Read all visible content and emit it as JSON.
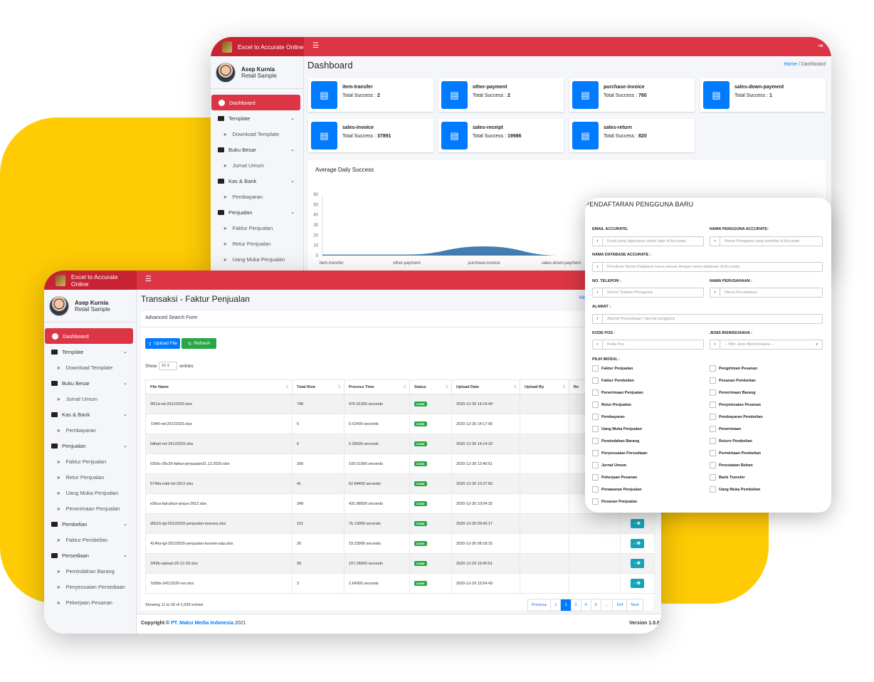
{
  "app": {
    "brand": "Excel to Accurate Online",
    "logout_icon": "logout-icon"
  },
  "user": {
    "name": "Asep Kurnia",
    "company": "Retail Sample"
  },
  "sidebar": {
    "dashboard": "Dashboard",
    "template": "Template",
    "download_template": "Download Template",
    "buku_besar": "Buku Besar",
    "jurnal_umum": "Jurnal Umum",
    "kas_bank": "Kas & Bank",
    "pembayaran": "Pembayaran",
    "penjualan": "Penjualan",
    "faktur_penjualan": "Faktur Penjualan",
    "retur_penjualan": "Retur Penjualan",
    "uang_muka_penjualan": "Uang Muka Penjualan",
    "penerimaan_penjualan": "Penerimaan Penjualan",
    "pembelian": "Pembelian",
    "faktur_pembelian": "Faktur Pembelian",
    "persediaan": "Persediaan",
    "pemindahan_barang": "Pemindahan Barang",
    "penyesuaian_persediaan": "Penyesuaian Persediaan",
    "pekerjaan_pesanan": "Pekerjaan Pesanan"
  },
  "dashboard": {
    "title": "Dashboard",
    "breadcrumb_home": "Home",
    "breadcrumb_sep": "/",
    "breadcrumb_current": "Dashboard",
    "cards": [
      {
        "name": "item-transfer",
        "label": "Total Success :",
        "value": "2"
      },
      {
        "name": "other-payment",
        "label": "Total Success :",
        "value": "2"
      },
      {
        "name": "purchase-invoice",
        "label": "Total Success :",
        "value": "780"
      },
      {
        "name": "sales-down-payment",
        "label": "Total Success :",
        "value": "1"
      },
      {
        "name": "sales-invoice",
        "label": "Total Success :",
        "value": "37891"
      },
      {
        "name": "sales-receipt",
        "label": "Total Success :",
        "value": "19986"
      },
      {
        "name": "sales-return",
        "label": "Total Success :",
        "value": "820"
      }
    ]
  },
  "chart_data": {
    "type": "area",
    "title": "Average Daily Success",
    "categories": [
      "item-transfer",
      "other-payment",
      "purchase-invoice",
      "sales-down-payment"
    ],
    "values": [
      1,
      1,
      9,
      0
    ],
    "ylim": [
      0,
      60
    ],
    "yticks": [
      "0",
      "10",
      "20",
      "30",
      "40",
      "50",
      "60"
    ],
    "color": "#2f6fa8"
  },
  "transaksi": {
    "title": "Transaksi - Faktur Penjualan",
    "breadcrumb_partial": "Ho",
    "search_form": "Advanced Search Form",
    "upload_label": "Upload File",
    "refresh_label": "Refresh",
    "show_label": "Show",
    "show_value": "10",
    "entries_label": "entries",
    "columns": [
      "File Name",
      "Total Row",
      "Process Time",
      "Status",
      "Upload Date",
      "Upload By",
      "Re"
    ],
    "rows": [
      {
        "file": "3f51d-nd-29122020.xlsx",
        "total": "798",
        "time": "476.91300 seconds",
        "status": "DONE",
        "date": "2020-12-30 14:19:44"
      },
      {
        "file": "7346f-nd-29122020.xlsx",
        "total": "5",
        "time": "0.02400 seconds",
        "status": "DONE",
        "date": "2020-12-30 14:17:06"
      },
      {
        "file": "0dba0-nd-29122020.xlsx",
        "total": "6",
        "time": "0.39500 seconds",
        "status": "DONE",
        "date": "2020-12-30 14:14:33"
      },
      {
        "file": "0359c-05c26-faktur-penjualan31.12.2020.xlsx",
        "total": "399",
        "time": "100.51900 seconds",
        "status": "DONE",
        "date": "2020-12-30 13:40:51"
      },
      {
        "file": "5749a-mkb-tsf-2912.xlsx",
        "total": "41",
        "time": "62.84400 seconds",
        "status": "DONE",
        "date": "2020-12-30 10:27:50"
      },
      {
        "file": "e2bca-bat-pbun-praya-2912.xlsx",
        "total": "348",
        "time": "431.88500 seconds",
        "status": "DONE",
        "date": "2020-12-30 10:04:32"
      },
      {
        "file": "d5516-tgl-29122020-penjualan-menara.xlsx",
        "total": "101",
        "time": "75.13000 seconds",
        "status": "DONE",
        "date": "2020-12-30 09:43:17"
      },
      {
        "file": "4146a-tgl-29122020-penjualan-bosnet-satp.xlsx",
        "total": "20",
        "time": "19.23900 seconds",
        "status": "DONE",
        "date": "2020-12-30 08:18:15"
      },
      {
        "file": "1f43b-upload-29-12-20.xlsx",
        "total": "99",
        "time": "107.28900 seconds",
        "status": "DONE",
        "date": "2020-12-29 16:40:51"
      },
      {
        "file": "7d2bb-24112020-rev.xlsx",
        "total": "3",
        "time": "2.64900 seconds",
        "status": "DONE",
        "date": "2020-12-29 15:54:43"
      }
    ],
    "info_button": "‹ ❶",
    "showing": "Showing 11 to 20 of 1,035 entries",
    "pagination": [
      "Previous",
      "1",
      "2",
      "3",
      "4",
      "5",
      "…",
      "104",
      "Next"
    ],
    "current_page": "2",
    "footer_prefix": "Copyright ©",
    "footer_company": "PT. Maksi Media Indonesia",
    "footer_year": "2021",
    "version": "Version 1.0.0"
  },
  "modal": {
    "title": "PENDAFTARAN PENGGUNA BARU",
    "email_label": "EMAIL ACCURATE:",
    "email_ph": "Email yang digunakan untuk login di Accurate",
    "username_label": "NAMA PENGGUNA ACCURATE:",
    "username_ph": "Nama Pengguna yang terdaftar di Accurate",
    "db_label": "NAMA DATABASE ACCURATE :",
    "db_ph": "Penulisan Nama Database harus sesuai dengan nama database di Accurate.",
    "phone_label": "NO. TELEPON :",
    "phone_ph": "Nomor Telepon Pengguna",
    "company_label": "NAMA PERUSAHAAN :",
    "company_ph": "Nama Perusahaan",
    "address_label": "ALAMAT :",
    "address_ph": "Alamat Perusahaan / alamat pengguna",
    "zip_label": "KODE POS :",
    "zip_ph": "Kode Pos",
    "biz_label": "JENIS BISNIS/USAHA :",
    "biz_ph": "-- Pilih Jenis Bisnis/Usaha --",
    "modules_label": "PILIH MODUL :",
    "modules_left": [
      "Faktur Penjualan",
      "Faktur Pembelian",
      "Penerimaan Penjualan",
      "Retur Penjualan",
      "Pembayaran",
      "Uang Muka Penjualan",
      "Pemindahan Barang",
      "Penyesuaian Persediaan",
      "Jurnal Umum",
      "Pekerjaan Pesanan",
      "Penawaran Penjualan",
      "Pesanan Penjualan"
    ],
    "modules_right": [
      "Pengiriman Pesanan",
      "Pesanan Pembelian",
      "Penerimaan Barang",
      "Penyelesaian Pesanan",
      "Pembayaran Pembelian",
      "Penerimaan",
      "Return Pembelian",
      "Permintaan Pembelian",
      "Pencatatan Beban",
      "Bank Transfer",
      "Uang Muka Pembelian"
    ]
  }
}
